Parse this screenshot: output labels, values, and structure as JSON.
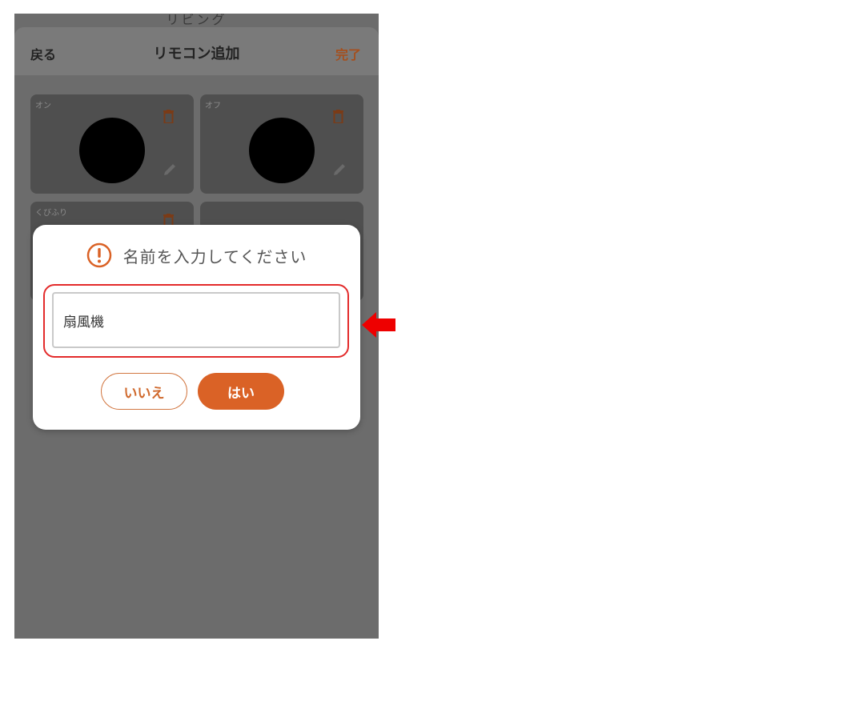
{
  "background_title": "リビング",
  "header": {
    "back_label": "戻る",
    "title": "リモコン追加",
    "done_label": "完了"
  },
  "cards": [
    {
      "label": "オン"
    },
    {
      "label": "オフ"
    },
    {
      "label": "くびふり"
    },
    {
      "label": ""
    }
  ],
  "dialog": {
    "title": "名前を入力してください",
    "input_value": "扇風機",
    "no_label": "いいえ",
    "yes_label": "はい"
  },
  "colors": {
    "accent": "#da6226",
    "overlay": "#6c6c6c",
    "highlight": "#e32b2b"
  },
  "icons": [
    "warning-icon",
    "trash-icon",
    "pencil-icon",
    "arrow-left-icon"
  ]
}
